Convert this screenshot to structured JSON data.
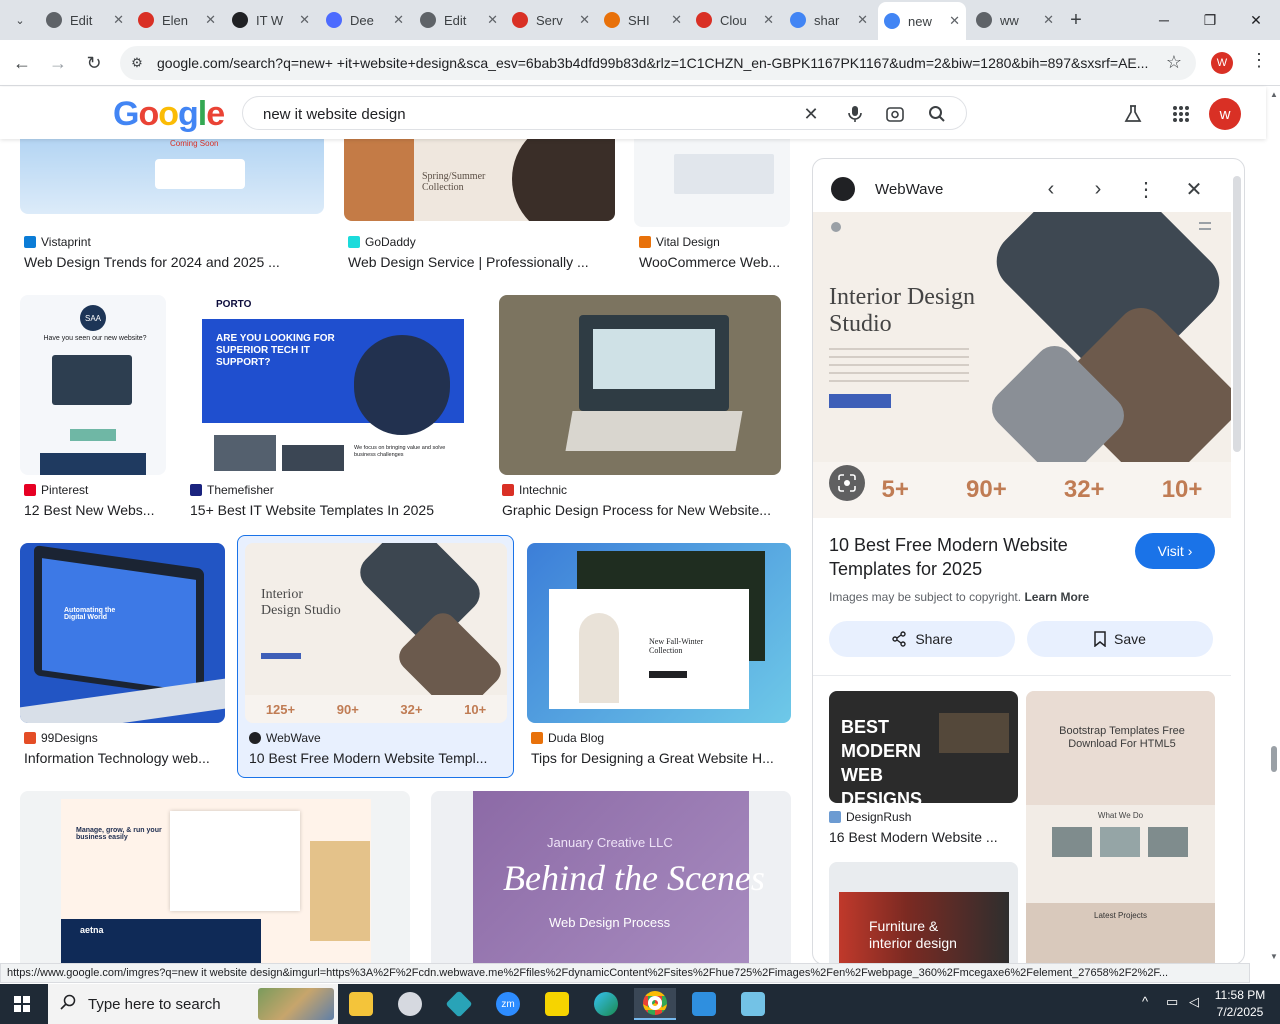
{
  "browser": {
    "tabs": [
      {
        "title": "Edit",
        "icon": "globe-icon",
        "color": "#5f6368"
      },
      {
        "title": "Elen",
        "icon": "diamond-icon",
        "color": "#d93025"
      },
      {
        "title": "IT W",
        "icon": "github-icon",
        "color": "#202124"
      },
      {
        "title": "Dee",
        "icon": "deepseek-icon",
        "color": "#4d6bfe"
      },
      {
        "title": "Edit",
        "icon": "globe-icon",
        "color": "#5f6368"
      },
      {
        "title": "Serv",
        "icon": "diamond-icon",
        "color": "#d93025"
      },
      {
        "title": "SHI",
        "icon": "ring-icon",
        "color": "#e8710a"
      },
      {
        "title": "Clou",
        "icon": "brush-icon",
        "color": "#d93025"
      },
      {
        "title": "shar",
        "icon": "google-icon",
        "color": "#4285f4"
      },
      {
        "title": "new",
        "icon": "google-icon",
        "color": "#4285f4",
        "active": true
      },
      {
        "title": "ww",
        "icon": "globe-icon",
        "color": "#5f6368"
      }
    ],
    "url": "google.com/search?q=new+ +it+website+design&sca_esv=6bab3b4dfd99b83d&rlz=1C1CHZN_en-GBPK1167PK1167&udm=2&biw=1280&bih=897&sxsrf=AE...",
    "profile_initial": "W",
    "status_url": "https://www.google.com/imgres?q=new  it website design&imgurl=https%3A%2F%2Fcdn.webwave.me%2Ffiles%2FdynamicContent%2Fsites%2Fhue725%2Fimages%2Fen%2Fwebpage_360%2Fmcegaxe6%2Felement_27658%2F2%2F..."
  },
  "google": {
    "logo_letters": [
      {
        "ch": "G",
        "color": "#4285f4"
      },
      {
        "ch": "o",
        "color": "#ea4335"
      },
      {
        "ch": "o",
        "color": "#fbbc05"
      },
      {
        "ch": "g",
        "color": "#4285f4"
      },
      {
        "ch": "l",
        "color": "#34a853"
      },
      {
        "ch": "e",
        "color": "#ea4335"
      }
    ],
    "query": "new it website design",
    "avatar_initial": "w"
  },
  "results": {
    "row1": [
      {
        "source": "Vistaprint",
        "title": "Web Design Trends for 2024 and 2025 ...",
        "color": "#0b7cd6"
      },
      {
        "source": "GoDaddy",
        "title": "Web Design Service | Professionally ...",
        "color": "#1bdbdb"
      },
      {
        "source": "Vital Design",
        "title": "WooCommerce Web...",
        "color": "#e8710a"
      }
    ],
    "row2": [
      {
        "source": "Pinterest",
        "title": "12 Best New Webs...",
        "color": "#e60023"
      },
      {
        "source": "Themefisher",
        "title": "15+ Best IT Website Templates In 2025",
        "color": "#1a237e"
      },
      {
        "source": "Intechnic",
        "title": "Graphic Design Process for New Website...",
        "color": "#d93025"
      }
    ],
    "row3": [
      {
        "source": "99Designs",
        "title": "Information Technology web...",
        "color": "#e44d26"
      },
      {
        "source": "WebWave",
        "title": "10 Best Free Modern Website Templ...",
        "color": "#202124"
      },
      {
        "source": "Duda Blog",
        "title": "Tips for Designing a Great Website H...",
        "color": "#e8710a"
      }
    ],
    "thumb_text": {
      "coming_soon": "Coming Soon",
      "spring": "Spring/Summer Collection",
      "saa_logo": "SAA",
      "saa_headline": "Have you seen our new website?",
      "porto_logo": "PORTO",
      "porto_headline": "ARE YOU LOOKING FOR SUPERIOR TECH IT SUPPORT?",
      "porto_sub": "We focus on bringing value and solve business challenges",
      "automating": "Automating the Digital World",
      "interior": "Interior Design Studio",
      "stats": [
        "125+",
        "90+",
        "32+",
        "10+"
      ],
      "fall": "New Fall-Winter Collection",
      "manage": "Manage, grow, & run your business easily",
      "aetna": "aetna",
      "january": "January Creative LLC",
      "behind": "Behind the Scenes",
      "web_process": "Web Design Process"
    }
  },
  "panel": {
    "site": "WebWave",
    "image_heading": "Interior Design Studio",
    "image_stats": [
      "5+",
      "90+",
      "32+",
      "10+"
    ],
    "title": "10 Best Free Modern Website Templates for 2025",
    "visit_label": "Visit",
    "copyright": "Images may be subject to copyright.",
    "learn_more": "Learn More",
    "share_label": "Share",
    "save_label": "Save",
    "related": [
      {
        "caption": "BEST MODERN WEB DESIGNS",
        "source": "DesignRush",
        "title": "16 Best Modern Website ...",
        "color": "#6c9bd2"
      },
      {
        "caption": "Bootstrap Templates Free Download For HTML5",
        "sub1": "What We Do",
        "sub2": "Latest Projects"
      },
      {
        "caption": "Furniture & interior design"
      }
    ]
  },
  "taskbar": {
    "search_placeholder": "Type here to search",
    "time": "11:58 PM",
    "date": "7/2/2025"
  }
}
